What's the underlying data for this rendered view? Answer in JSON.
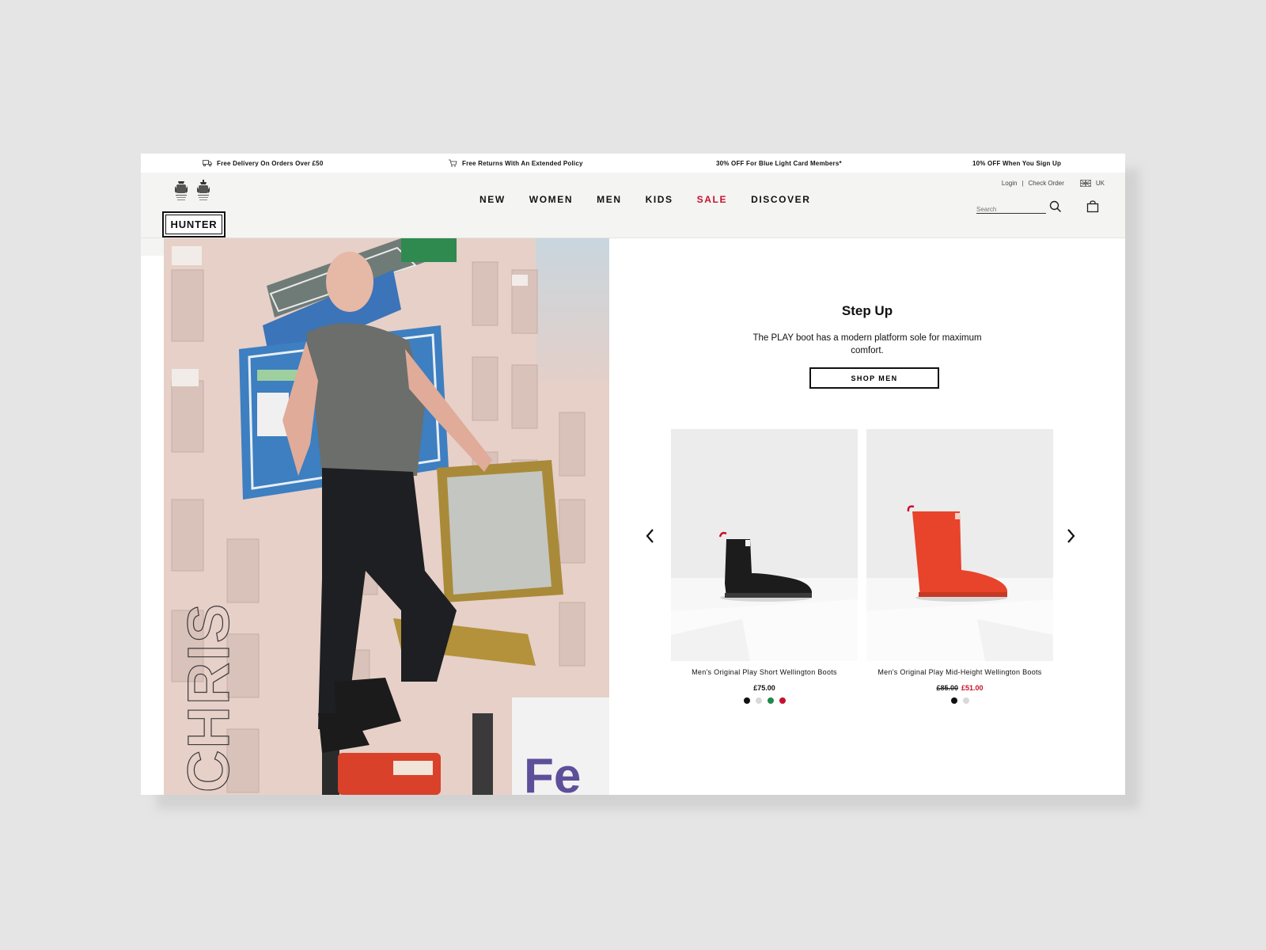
{
  "promo_bar": [
    {
      "icon": "truck-icon",
      "text": "Free Delivery On Orders Over £50"
    },
    {
      "icon": "returns-icon",
      "text": "Free Returns With An Extended Policy"
    },
    {
      "icon": "",
      "text": "30% OFF For Blue Light Card Members*"
    },
    {
      "icon": "",
      "text": "10% OFF When You Sign Up"
    }
  ],
  "header": {
    "logo_text": "HUNTER",
    "nav": [
      "NEW",
      "WOMEN",
      "MEN",
      "KIDS",
      "SALE",
      "DISCOVER"
    ],
    "login": "Login",
    "separator": "|",
    "check_order": "Check Order",
    "region": "UK",
    "search_placeholder": "Search"
  },
  "hero": {
    "vertical_name": "CHRIS"
  },
  "feature": {
    "heading": "Step Up",
    "subtext": "The PLAY boot has a modern platform sole for maximum comfort.",
    "cta": "SHOP MEN"
  },
  "products": [
    {
      "name": "Men's Original Play Short Wellington Boots",
      "price": "£75.00",
      "was_price": "",
      "swatches": [
        "#111111",
        "#d9d9d9",
        "#1f8a4c",
        "#c8102e"
      ]
    },
    {
      "name": "Men's Original Play Mid-Height Wellington Boots",
      "price": "£51.00",
      "was_price": "£85.00",
      "swatches": [
        "#111111",
        "#d9d9d9"
      ]
    }
  ],
  "colors": {
    "sale": "#c8102e",
    "header_bg": "#f4f4f2",
    "page_bg": "#e5e5e5"
  }
}
